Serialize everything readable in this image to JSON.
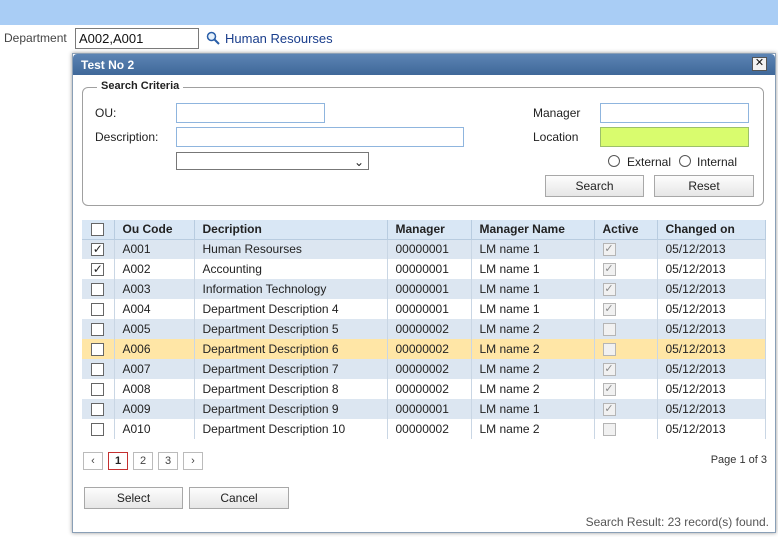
{
  "outer": {
    "department_label": "Department",
    "department_value": "A002,A001",
    "department_name": "Human Resourses"
  },
  "dialog": {
    "title": "Test No 2",
    "close_glyph": "✕",
    "criteria": {
      "legend": "Search Criteria",
      "ou_label": "OU:",
      "description_label": "Description:",
      "manager_label": "Manager",
      "location_label": "Location",
      "external_label": "External",
      "internal_label": "Internal",
      "search_label": "Search",
      "reset_label": "Reset",
      "location_color": "#d9fc6e"
    },
    "grid": {
      "headers": [
        "Ou Code",
        "Decription",
        "Manager",
        "Manager Name",
        "Active",
        "Changed on"
      ],
      "rows": [
        {
          "checked": true,
          "code": "A001",
          "desc": "Human Resourses",
          "manager": "00000001",
          "mname": "LM name 1",
          "active": true,
          "changed": "05/12/2013"
        },
        {
          "checked": true,
          "code": "A002",
          "desc": "Accounting",
          "manager": "00000001",
          "mname": "LM name 1",
          "active": true,
          "changed": "05/12/2013"
        },
        {
          "checked": false,
          "code": "A003",
          "desc": "Information Technology",
          "manager": "00000001",
          "mname": "LM name 1",
          "active": true,
          "changed": "05/12/2013"
        },
        {
          "checked": false,
          "code": "A004",
          "desc": "Department Description 4",
          "manager": "00000001",
          "mname": "LM name 1",
          "active": true,
          "changed": "05/12/2013"
        },
        {
          "checked": false,
          "code": "A005",
          "desc": "Department Description 5",
          "manager": "00000002",
          "mname": "LM name 2",
          "active": false,
          "changed": "05/12/2013"
        },
        {
          "checked": false,
          "code": "A006",
          "desc": "Department Description 6",
          "manager": "00000002",
          "mname": "LM name 2",
          "active": false,
          "changed": "05/12/2013"
        },
        {
          "checked": false,
          "code": "A007",
          "desc": "Department Description 7",
          "manager": "00000002",
          "mname": "LM name 2",
          "active": true,
          "changed": "05/12/2013"
        },
        {
          "checked": false,
          "code": "A008",
          "desc": "Department Description 8",
          "manager": "00000002",
          "mname": "LM name 2",
          "active": true,
          "changed": "05/12/2013"
        },
        {
          "checked": false,
          "code": "A009",
          "desc": "Department Description 9",
          "manager": "00000001",
          "mname": "LM name 1",
          "active": true,
          "changed": "05/12/2013"
        },
        {
          "checked": false,
          "code": "A010",
          "desc": "Department Description 10",
          "manager": "00000002",
          "mname": "LM name 2",
          "active": false,
          "changed": "05/12/2013"
        }
      ],
      "selected_row": 5
    },
    "pager": {
      "prev": "‹",
      "pages": [
        "1",
        "2",
        "3"
      ],
      "next": "›",
      "current": "1",
      "page_info": "Page 1 of 3"
    },
    "footer": {
      "select_label": "Select",
      "cancel_label": "Cancel",
      "status": "Search Result: 23 record(s) found."
    }
  }
}
